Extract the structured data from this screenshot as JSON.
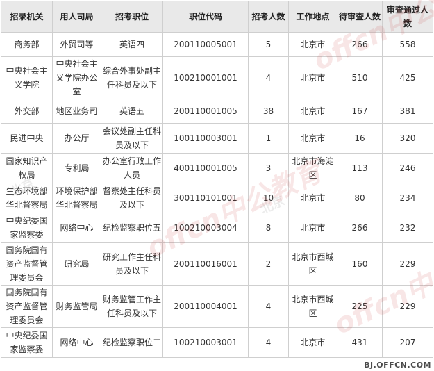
{
  "table": {
    "headers": [
      "招录机关",
      "用人司局",
      "招考职位",
      "职位代码",
      "招考人数",
      "工作地点",
      "待审查人数",
      "审查通过人数"
    ],
    "rows": [
      [
        "商务部",
        "外贸司等",
        "英语四",
        "200110005001",
        "5",
        "北京市",
        "266",
        "558"
      ],
      [
        "中央社会主义学院",
        "中央社会主义学院办公室",
        "综合外事处副主任科员及以下",
        "100210001001",
        "4",
        "北京市",
        "510",
        "425"
      ],
      [
        "外交部",
        "地区业务司",
        "英语五",
        "200110001005",
        "38",
        "北京市",
        "167",
        "381"
      ],
      [
        "民进中央",
        "办公厅",
        "会议处副主任科员及以下",
        "100110003001",
        "1",
        "北京市",
        "16",
        "320"
      ],
      [
        "国家知识产权局",
        "专利局",
        "办公室行政工作人员",
        "400110001005",
        "3",
        "北京市海淀区",
        "113",
        "246"
      ],
      [
        "生态环境部华北督察局",
        "环境保护部华北督察局",
        "督察处主任科员及以下",
        "300110101001",
        "10",
        "北京市",
        "80",
        "234"
      ],
      [
        "中央纪委国家监察委",
        "网络中心",
        "纪检监察职位五",
        "100210003004",
        "8",
        "北京市",
        "266",
        "232"
      ],
      [
        "国务院国有资产监督管理委员会",
        "研究局",
        "研究工作主任科员及以下",
        "200110016001",
        "2",
        "北京市西城区",
        "160",
        "229"
      ],
      [
        "国务院国有资产监督管理委员会",
        "财务监管局",
        "财务监管工作主任科员及以下",
        "200110004001",
        "4",
        "北京市西城区",
        "225",
        "229"
      ],
      [
        "中央纪委国家监察委",
        "网络中心",
        "纪检监察职位二",
        "100210003001",
        "4",
        "北京市",
        "431",
        "207"
      ]
    ]
  },
  "watermark": {
    "brand_latin": "offcn",
    "brand_cn": "中公教育",
    "city": "北京"
  },
  "footer": {
    "url": "BJ.OFFCN.COM"
  }
}
